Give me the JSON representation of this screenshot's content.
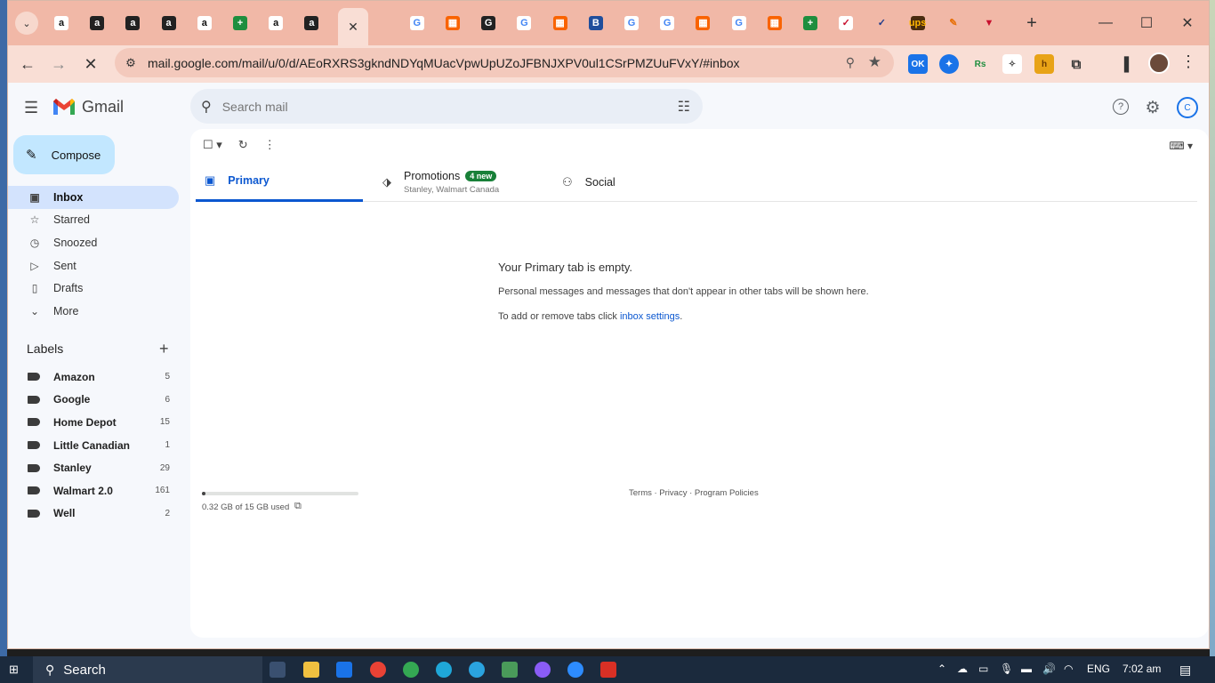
{
  "browser": {
    "url": "mail.google.com/mail/u/0/d/AEoRXRS3gkndNDYqMUacVpwUpUZoJFBNJXPV0ul1CSrPMZUuFVxY/#inbox",
    "tabs": [
      {
        "glyph": "a",
        "bg": "#ffffff",
        "fg": "#111111"
      },
      {
        "glyph": "a",
        "bg": "#222222",
        "fg": "#ffffff"
      },
      {
        "glyph": "a",
        "bg": "#222222",
        "fg": "#ffffff"
      },
      {
        "glyph": "a",
        "bg": "#222222",
        "fg": "#ffffff"
      },
      {
        "glyph": "a",
        "bg": "#ffffff",
        "fg": "#111111"
      },
      {
        "glyph": "+",
        "bg": "#1e8e3e",
        "fg": "#ffffff"
      },
      {
        "glyph": "a",
        "bg": "#ffffff",
        "fg": "#111111"
      },
      {
        "glyph": "a",
        "bg": "#222222",
        "fg": "#ffffff"
      },
      {
        "glyph": "G",
        "bg": "#ffffff",
        "fg": "#4285f4"
      },
      {
        "glyph": "G",
        "bg": "#ffffff",
        "fg": "#4285f4"
      },
      {
        "glyph": "▦",
        "bg": "#f96302",
        "fg": "#ffffff"
      },
      {
        "glyph": "G",
        "bg": "#222222",
        "fg": "#ffffff"
      },
      {
        "glyph": "G",
        "bg": "#ffffff",
        "fg": "#4285f4"
      },
      {
        "glyph": "▦",
        "bg": "#f96302",
        "fg": "#ffffff"
      },
      {
        "glyph": "B",
        "bg": "#1f4e9c",
        "fg": "#ffffff"
      },
      {
        "glyph": "G",
        "bg": "#ffffff",
        "fg": "#4285f4"
      },
      {
        "glyph": "G",
        "bg": "#ffffff",
        "fg": "#4285f4"
      },
      {
        "glyph": "▦",
        "bg": "#f96302",
        "fg": "#ffffff"
      },
      {
        "glyph": "G",
        "bg": "#ffffff",
        "fg": "#4285f4"
      },
      {
        "glyph": "▦",
        "bg": "#f96302",
        "fg": "#ffffff"
      },
      {
        "glyph": "+",
        "bg": "#1e8e3e",
        "fg": "#ffffff"
      },
      {
        "glyph": "✓",
        "bg": "#ffffff",
        "fg": "#c8102e"
      },
      {
        "glyph": "✓",
        "bg": "#f1b8a7",
        "fg": "#1f3b8c"
      },
      {
        "glyph": "ups",
        "bg": "#4a2c0f",
        "fg": "#ffb500"
      },
      {
        "glyph": "✎",
        "bg": "#f1b8a7",
        "fg": "#e8710a"
      },
      {
        "glyph": "▼",
        "bg": "#f1b8a7",
        "fg": "#c8102e"
      }
    ]
  },
  "gmail": {
    "brand": "Gmail",
    "search_placeholder": "Search mail",
    "compose_label": "Compose",
    "nav": [
      {
        "label": "Inbox",
        "icon": "inbox-icon",
        "glyph": "▣",
        "active": true
      },
      {
        "label": "Starred",
        "icon": "star-icon",
        "glyph": "☆",
        "active": false
      },
      {
        "label": "Snoozed",
        "icon": "clock-icon",
        "glyph": "◷",
        "active": false
      },
      {
        "label": "Sent",
        "icon": "send-icon",
        "glyph": "▷",
        "active": false
      },
      {
        "label": "Drafts",
        "icon": "draft-icon",
        "glyph": "▯",
        "active": false
      },
      {
        "label": "More",
        "icon": "chevron-down-icon",
        "glyph": "⌄",
        "active": false
      }
    ],
    "labels_heading": "Labels",
    "labels": [
      {
        "name": "Amazon",
        "count": "5"
      },
      {
        "name": "Google",
        "count": "6"
      },
      {
        "name": "Home Depot",
        "count": "15"
      },
      {
        "name": "Little Canadian",
        "count": "1"
      },
      {
        "name": "Stanley",
        "count": "29"
      },
      {
        "name": "Walmart 2.0",
        "count": "161"
      },
      {
        "name": "Well",
        "count": "2"
      }
    ],
    "tabs": {
      "primary": "Primary",
      "promotions": "Promotions",
      "promotions_badge": "4 new",
      "promotions_sub": "Stanley, Walmart Canada",
      "social": "Social"
    },
    "empty_title": "Your Primary tab is empty.",
    "empty_line1": "Personal messages and messages that don't appear in other tabs will be shown here.",
    "empty_line2_pre": "To add or remove tabs click ",
    "empty_link": "inbox settings",
    "empty_line2_post": ".",
    "storage_text": "0.32 GB of 15 GB used",
    "storage_fraction": 0.021,
    "footer": "Terms · Privacy · Program Policies"
  },
  "taskbar": {
    "search_label": "Search",
    "language": "ENG",
    "time": "7:02 am"
  }
}
